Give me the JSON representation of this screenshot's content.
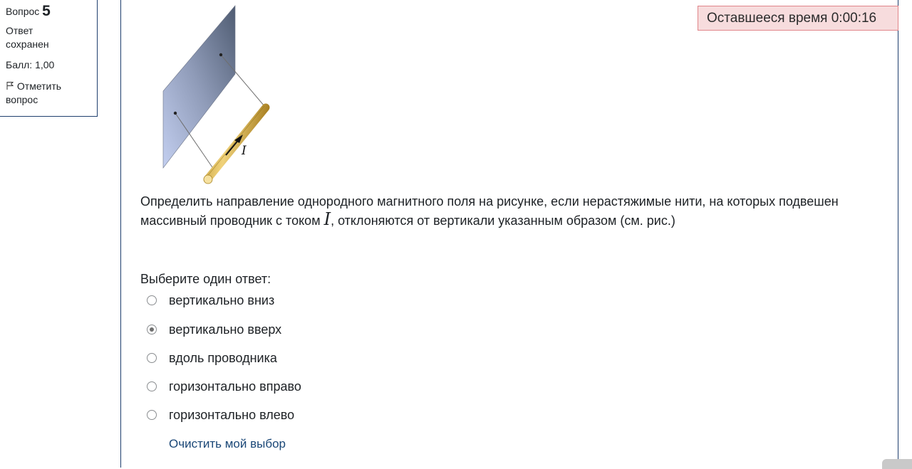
{
  "info": {
    "question_label": "Вопрос",
    "question_number": "5",
    "state": "Ответ сохранен",
    "grade": "Балл: 1,00",
    "flag_label": "Отметить вопрос"
  },
  "timer": {
    "text": "Оставшееся время 0:00:16"
  },
  "figure": {
    "current_label": "I"
  },
  "question": {
    "text_before": "Определить направление однородного магнитного поля на рисунке, если нерастяжимые нити, на которых подвешен массивный проводник с током ",
    "symbol": "I",
    "text_after": ", отклоняются от вертикали указанным образом (см. рис.)"
  },
  "prompt": "Выберите один ответ:",
  "options": [
    {
      "label": "вертикально вниз",
      "selected": false
    },
    {
      "label": "вертикально вверх",
      "selected": true
    },
    {
      "label": "вдоль проводника",
      "selected": false
    },
    {
      "label": "горизонтально вправо",
      "selected": false
    },
    {
      "label": "горизонтально влево",
      "selected": false
    }
  ],
  "clear_choice": "Очистить мой выбор",
  "colors": {
    "accent": "#1f3f6e",
    "timer_bg": "#f7dcdd",
    "timer_border": "#e0858a",
    "link": "#1a4777",
    "rod": "#d9b44a"
  }
}
